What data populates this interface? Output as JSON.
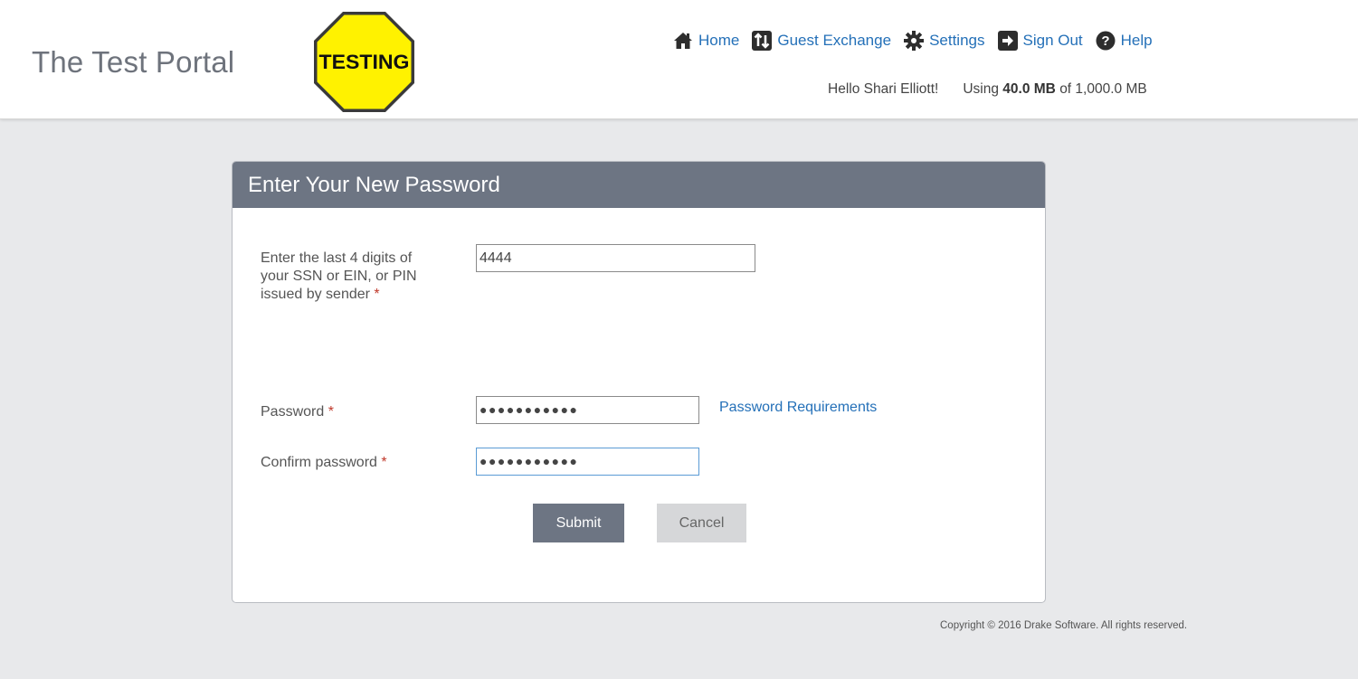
{
  "header": {
    "portal_title": "The Test Portal",
    "logo_text": "TESTING",
    "logo_color": "#fff200",
    "nav": [
      {
        "label": "Home",
        "icon": "home-icon"
      },
      {
        "label": "Guest Exchange",
        "icon": "exchange-icon"
      },
      {
        "label": "Settings",
        "icon": "gear-icon"
      },
      {
        "label": "Sign Out",
        "icon": "sign-out-icon"
      },
      {
        "label": "Help",
        "icon": "help-icon"
      }
    ],
    "greeting": "Hello Shari Elliott!",
    "usage_prefix": "Using",
    "usage_used": "40.0 MB",
    "usage_suffix": "of 1,000.0 MB"
  },
  "form": {
    "title": "Enter Your New Password",
    "ssn_label_line1": "Enter the last 4 digits of",
    "ssn_label_line2": "your SSN or EIN, or PIN",
    "ssn_label_line3": "issued by sender",
    "ssn_value": "4444",
    "password_label": "Password",
    "password_dots": "●●●●●●●●●●●",
    "password_requirements_link": "Password Requirements",
    "confirm_label": "Confirm password",
    "confirm_dots": "●●●●●●●●●●●",
    "required_marker": "*",
    "submit_label": "Submit",
    "cancel_label": "Cancel"
  },
  "footer": {
    "copyright": "Copyright © 2016 Drake Software. All rights reserved."
  },
  "colors": {
    "accent": "#2470b8",
    "panel_header": "#6d7583",
    "background": "#e8e9eb"
  }
}
